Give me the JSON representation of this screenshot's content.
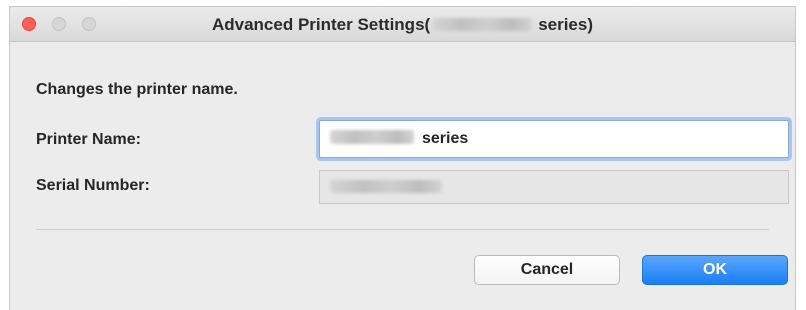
{
  "window": {
    "title_prefix": "Advanced Printer Settings(",
    "title_suffix": "series)",
    "controls": [
      "close",
      "minimize",
      "zoom"
    ]
  },
  "dialog": {
    "description": "Changes the printer name.",
    "printer_name_label": "Printer Name:",
    "printer_name_value_suffix": "series",
    "serial_number_label": "Serial Number:"
  },
  "buttons": {
    "cancel": "Cancel",
    "ok": "OK"
  },
  "colors": {
    "close_button": "#fc5f57",
    "ok_button": "#1b7ef5",
    "focus_ring": "#a9c6f2"
  }
}
